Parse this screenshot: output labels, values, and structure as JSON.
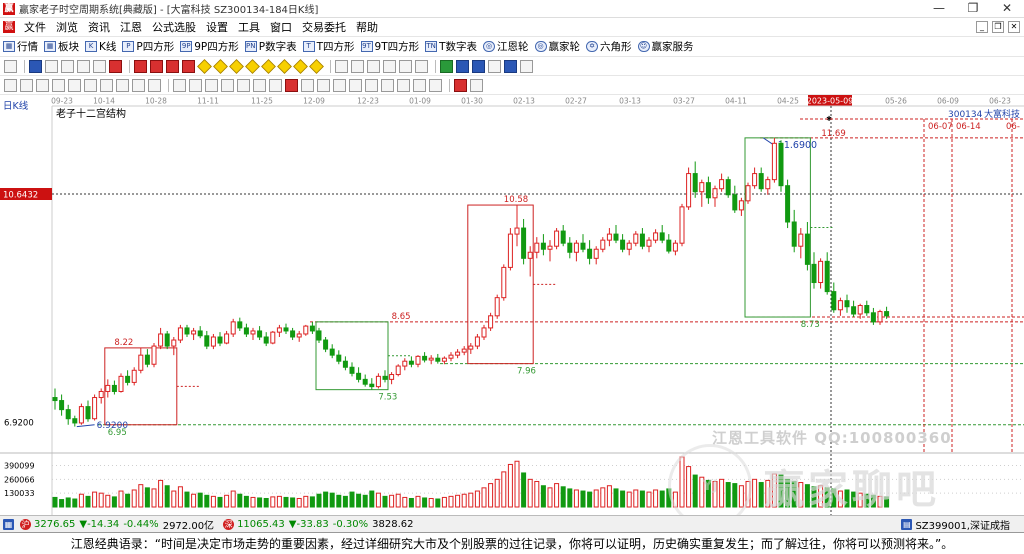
{
  "window": {
    "title": "赢家老子时空周期系统[典藏版] - [大富科技  SZ300134-184日K线]",
    "app_icon": "赢",
    "controls": [
      "—",
      "❐",
      "✕"
    ]
  },
  "menu": {
    "icon": "赢",
    "items": [
      "文件",
      "浏览",
      "资讯",
      "江恩",
      "公式选股",
      "设置",
      "工具",
      "窗口",
      "交易委托",
      "帮助"
    ],
    "mdi": [
      "_",
      "❐",
      "✕"
    ]
  },
  "toolbar1": {
    "items": [
      {
        "icon": "table-icon",
        "glyph": "▦",
        "label": "行情"
      },
      {
        "icon": "blocks-icon",
        "glyph": "▦",
        "label": "板块"
      },
      {
        "icon": "kline-icon",
        "glyph": "K",
        "label": "K线"
      },
      {
        "icon": "p-square-icon",
        "glyph": "P",
        "label": "P四方形"
      },
      {
        "icon": "9p-square-icon",
        "glyph": "9P",
        "label": "9P四方形"
      },
      {
        "icon": "pn-table-icon",
        "glyph": "PN",
        "label": "P数字表"
      },
      {
        "icon": "t-square-icon",
        "glyph": "T",
        "label": "T四方形"
      },
      {
        "icon": "9t-square-icon",
        "glyph": "9T",
        "label": "9T四方形"
      },
      {
        "icon": "tn-table-icon",
        "glyph": "TN",
        "label": "T数字表"
      },
      {
        "icon": "gann-wheel-icon",
        "glyph": "◎",
        "label": "江恩轮",
        "round": true
      },
      {
        "icon": "winner-wheel-icon",
        "glyph": "◎",
        "label": "赢家轮",
        "round": true
      },
      {
        "icon": "hexagon-icon",
        "glyph": "✡",
        "label": "六角形",
        "round": true
      },
      {
        "icon": "winner-service-icon",
        "glyph": "☺",
        "label": "赢家服务",
        "round": true
      }
    ]
  },
  "chart": {
    "period_label": "日K线",
    "indicator_title": "老子十二宫结构",
    "stock_name": "大富科技",
    "stock_code": "300134",
    "crosshair_price": "10.6432",
    "crosshair_date": "2023-05-09",
    "date_ticks": [
      "09-23",
      "10-14",
      "10-28",
      "11-11",
      "11-25",
      "12-09",
      "12-23",
      "01-09",
      "01-30",
      "02-13",
      "02-27",
      "03-13",
      "03-27",
      "04-11",
      "04-25",
      "2023-05-09",
      "05-26",
      "06-09",
      "06-23"
    ],
    "future_dates": [
      "06-07",
      "06-14",
      "06-"
    ],
    "price_labels": {
      "high": "11.6900",
      "low": "6.9200",
      "axis_low": "6.9200",
      "dotted_high": "11.69",
      "box1_top": "8.22",
      "box1_bottom": "6.95",
      "box2_top": "8.65",
      "box2_bottom": "7.53",
      "box3_top": "10.58",
      "box3_bottom": "7.96",
      "box4_bottom": "8.73"
    },
    "volume_axis": [
      "390099",
      "260066",
      "130033"
    ]
  },
  "chart_data": {
    "type": "candlestick",
    "title": "老子十二宫结构",
    "ylim": [
      6.5,
      12.2
    ],
    "volume_max": 470000,
    "candles": [
      [
        7.4,
        7.55,
        7.2,
        7.35
      ],
      [
        7.35,
        7.45,
        7.1,
        7.2
      ],
      [
        7.2,
        7.28,
        6.95,
        7.05
      ],
      [
        7.05,
        7.1,
        6.92,
        6.98
      ],
      [
        6.98,
        7.3,
        6.95,
        7.25
      ],
      [
        7.25,
        7.35,
        7.0,
        7.05
      ],
      [
        7.05,
        7.45,
        7.02,
        7.4
      ],
      [
        7.4,
        7.55,
        7.3,
        7.5
      ],
      [
        7.5,
        7.7,
        7.4,
        7.6
      ],
      [
        7.6,
        7.68,
        7.45,
        7.5
      ],
      [
        7.5,
        7.8,
        7.48,
        7.75
      ],
      [
        7.75,
        7.85,
        7.6,
        7.65
      ],
      [
        7.65,
        7.9,
        7.6,
        7.85
      ],
      [
        7.85,
        8.22,
        7.8,
        8.1
      ],
      [
        8.1,
        8.2,
        7.9,
        7.95
      ],
      [
        7.95,
        8.3,
        7.9,
        8.25
      ],
      [
        8.25,
        8.55,
        8.2,
        8.45
      ],
      [
        8.45,
        8.5,
        8.2,
        8.25
      ],
      [
        8.25,
        8.4,
        8.1,
        8.35
      ],
      [
        8.35,
        8.6,
        8.3,
        8.55
      ],
      [
        8.55,
        8.6,
        8.4,
        8.45
      ],
      [
        8.45,
        8.55,
        8.35,
        8.5
      ],
      [
        8.5,
        8.58,
        8.38,
        8.42
      ],
      [
        8.42,
        8.5,
        8.2,
        8.25
      ],
      [
        8.25,
        8.45,
        8.2,
        8.4
      ],
      [
        8.4,
        8.48,
        8.25,
        8.3
      ],
      [
        8.3,
        8.5,
        8.28,
        8.45
      ],
      [
        8.45,
        8.7,
        8.4,
        8.65
      ],
      [
        8.65,
        8.72,
        8.5,
        8.55
      ],
      [
        8.55,
        8.62,
        8.4,
        8.45
      ],
      [
        8.45,
        8.55,
        8.35,
        8.5
      ],
      [
        8.5,
        8.58,
        8.35,
        8.4
      ],
      [
        8.4,
        8.48,
        8.25,
        8.3
      ],
      [
        8.3,
        8.5,
        8.28,
        8.48
      ],
      [
        8.48,
        8.6,
        8.4,
        8.55
      ],
      [
        8.55,
        8.62,
        8.45,
        8.5
      ],
      [
        8.5,
        8.55,
        8.35,
        8.4
      ],
      [
        8.4,
        8.5,
        8.32,
        8.45
      ],
      [
        8.45,
        8.6,
        8.42,
        8.58
      ],
      [
        8.58,
        8.65,
        8.45,
        8.5
      ],
      [
        8.5,
        8.55,
        8.3,
        8.35
      ],
      [
        8.35,
        8.4,
        8.15,
        8.2
      ],
      [
        8.2,
        8.28,
        8.05,
        8.1
      ],
      [
        8.1,
        8.18,
        7.95,
        8.0
      ],
      [
        8.0,
        8.08,
        7.85,
        7.9
      ],
      [
        7.9,
        7.98,
        7.75,
        7.8
      ],
      [
        7.8,
        7.9,
        7.65,
        7.7
      ],
      [
        7.7,
        7.78,
        7.58,
        7.62
      ],
      [
        7.62,
        7.72,
        7.53,
        7.58
      ],
      [
        7.58,
        7.8,
        7.55,
        7.75
      ],
      [
        7.75,
        7.85,
        7.65,
        7.7
      ],
      [
        7.7,
        7.82,
        7.62,
        7.78
      ],
      [
        7.78,
        7.95,
        7.75,
        7.92
      ],
      [
        7.92,
        8.05,
        7.85,
        8.0
      ],
      [
        8.0,
        8.08,
        7.9,
        7.95
      ],
      [
        7.95,
        8.1,
        7.9,
        8.08
      ],
      [
        8.08,
        8.15,
        7.98,
        8.02
      ],
      [
        8.02,
        8.1,
        7.95,
        8.05
      ],
      [
        8.05,
        8.12,
        7.96,
        8.0
      ],
      [
        8.0,
        8.08,
        7.95,
        8.05
      ],
      [
        8.05,
        8.15,
        8.0,
        8.1
      ],
      [
        8.1,
        8.2,
        8.05,
        8.15
      ],
      [
        8.15,
        8.25,
        8.1,
        8.2
      ],
      [
        8.2,
        8.3,
        8.12,
        8.25
      ],
      [
        8.25,
        8.45,
        8.2,
        8.4
      ],
      [
        8.4,
        8.6,
        8.35,
        8.55
      ],
      [
        8.55,
        8.8,
        8.5,
        8.75
      ],
      [
        8.75,
        9.1,
        8.7,
        9.05
      ],
      [
        9.05,
        9.6,
        9.0,
        9.55
      ],
      [
        9.55,
        10.2,
        9.5,
        10.1
      ],
      [
        10.1,
        10.58,
        9.9,
        10.2
      ],
      [
        10.2,
        10.35,
        9.6,
        9.7
      ],
      [
        9.7,
        9.9,
        9.4,
        9.8
      ],
      [
        9.8,
        10.05,
        9.7,
        9.95
      ],
      [
        9.95,
        10.1,
        9.75,
        9.85
      ],
      [
        9.85,
        10.0,
        9.65,
        9.9
      ],
      [
        9.9,
        10.2,
        9.85,
        10.15
      ],
      [
        10.15,
        10.25,
        9.9,
        9.95
      ],
      [
        9.95,
        10.05,
        9.7,
        9.8
      ],
      [
        9.8,
        10.0,
        9.65,
        9.95
      ],
      [
        9.95,
        10.1,
        9.8,
        9.85
      ],
      [
        9.85,
        10.0,
        9.6,
        9.7
      ],
      [
        9.7,
        9.9,
        9.6,
        9.85
      ],
      [
        9.85,
        10.05,
        9.8,
        10.0
      ],
      [
        10.0,
        10.2,
        9.9,
        10.1
      ],
      [
        10.1,
        10.25,
        9.95,
        10.0
      ],
      [
        10.0,
        10.1,
        9.8,
        9.85
      ],
      [
        9.85,
        10.0,
        9.75,
        9.95
      ],
      [
        9.95,
        10.15,
        9.9,
        10.1
      ],
      [
        10.1,
        10.2,
        9.85,
        9.9
      ],
      [
        9.9,
        10.05,
        9.8,
        10.0
      ],
      [
        10.0,
        10.18,
        9.95,
        10.12
      ],
      [
        10.12,
        10.25,
        9.95,
        10.0
      ],
      [
        10.0,
        10.1,
        9.78,
        9.82
      ],
      [
        9.82,
        10.0,
        9.75,
        9.95
      ],
      [
        9.95,
        10.6,
        9.9,
        10.55
      ],
      [
        10.55,
        11.2,
        10.5,
        11.1
      ],
      [
        11.1,
        11.3,
        10.7,
        10.8
      ],
      [
        10.8,
        11.0,
        10.55,
        10.95
      ],
      [
        10.95,
        11.05,
        10.6,
        10.7
      ],
      [
        10.7,
        10.9,
        10.55,
        10.85
      ],
      [
        10.85,
        11.1,
        10.8,
        11.0
      ],
      [
        11.0,
        11.05,
        10.7,
        10.75
      ],
      [
        10.75,
        10.9,
        10.45,
        10.5
      ],
      [
        10.5,
        10.7,
        10.4,
        10.65
      ],
      [
        10.65,
        10.95,
        10.6,
        10.9
      ],
      [
        10.9,
        11.2,
        10.85,
        11.1
      ],
      [
        11.1,
        11.2,
        10.8,
        10.85
      ],
      [
        10.85,
        11.05,
        10.75,
        11.0
      ],
      [
        11.0,
        11.69,
        10.95,
        11.6
      ],
      [
        11.6,
        11.65,
        10.8,
        10.9
      ],
      [
        10.9,
        11.0,
        10.2,
        10.3
      ],
      [
        10.3,
        10.5,
        9.8,
        9.9
      ],
      [
        9.9,
        10.2,
        9.7,
        10.1
      ],
      [
        10.1,
        10.3,
        9.5,
        9.6
      ],
      [
        9.6,
        9.8,
        9.2,
        9.3
      ],
      [
        9.3,
        9.7,
        9.2,
        9.65
      ],
      [
        9.65,
        9.8,
        9.1,
        9.15
      ],
      [
        9.15,
        9.3,
        8.8,
        8.85
      ],
      [
        8.85,
        9.05,
        8.75,
        9.0
      ],
      [
        9.0,
        9.1,
        8.8,
        8.9
      ],
      [
        8.9,
        9.0,
        8.73,
        8.78
      ],
      [
        8.78,
        8.95,
        8.7,
        8.92
      ],
      [
        8.92,
        9.0,
        8.75,
        8.8
      ],
      [
        8.8,
        8.88,
        8.6,
        8.65
      ],
      [
        8.65,
        8.85,
        8.6,
        8.82
      ],
      [
        8.82,
        8.9,
        8.7,
        8.75
      ]
    ],
    "volumes": [
      90,
      70,
      85,
      75,
      120,
      100,
      140,
      130,
      110,
      95,
      150,
      120,
      160,
      210,
      180,
      170,
      250,
      200,
      150,
      190,
      140,
      120,
      130,
      110,
      100,
      90,
      110,
      150,
      120,
      100,
      90,
      85,
      80,
      95,
      100,
      90,
      85,
      80,
      100,
      95,
      120,
      140,
      130,
      110,
      100,
      140,
      120,
      110,
      150,
      130,
      100,
      110,
      120,
      90,
      80,
      100,
      85,
      80,
      75,
      90,
      100,
      110,
      120,
      130,
      150,
      180,
      220,
      260,
      330,
      400,
      430,
      320,
      260,
      240,
      200,
      180,
      220,
      190,
      170,
      160,
      150,
      140,
      160,
      180,
      200,
      170,
      150,
      140,
      160,
      150,
      140,
      160,
      150,
      170,
      140,
      470,
      380,
      300,
      280,
      250,
      240,
      260,
      230,
      220,
      200,
      240,
      260,
      230,
      250,
      310,
      300,
      260,
      240,
      230,
      210,
      190,
      200,
      180,
      170,
      150,
      160,
      140,
      130,
      120,
      110,
      100,
      95,
      90
    ],
    "boxes": [
      {
        "color": "#cc2222",
        "start": 8,
        "end": 18,
        "top": 8.22,
        "bottom": 6.95
      },
      {
        "color": "#339933",
        "start": 40,
        "end": 50,
        "top": 8.65,
        "bottom": 7.53
      },
      {
        "color": "#cc2222",
        "start": 63,
        "end": 72,
        "top": 10.58,
        "bottom": 7.96
      },
      {
        "color": "#339933",
        "start": 105,
        "end": 114,
        "top": 11.69,
        "bottom": 8.73
      }
    ]
  },
  "status": {
    "sh_index": "3276.65",
    "sh_change": "-14.34",
    "sh_pct": "-0.44%",
    "sh_amount": "2972.00亿",
    "sz_index": "11065.43",
    "sz_change": "-33.83",
    "sz_pct": "-0.30%",
    "sz_amount": "3828.62",
    "code_box": "SZ399001,深证成指",
    "icon_sh": "沪",
    "icon_sz": "深"
  },
  "quote": "江恩经典语录：“时间是决定市场走势的重要因素，经过详细研究大市及个别股票的过往记录，你将可以证明，历史确实重复发生；而了解过往，你将可以预测将来。”。",
  "watermark": {
    "top": "江恩工具软件  QQ:100800360",
    "logo": "YJ",
    "main": "赢家聊吧"
  }
}
